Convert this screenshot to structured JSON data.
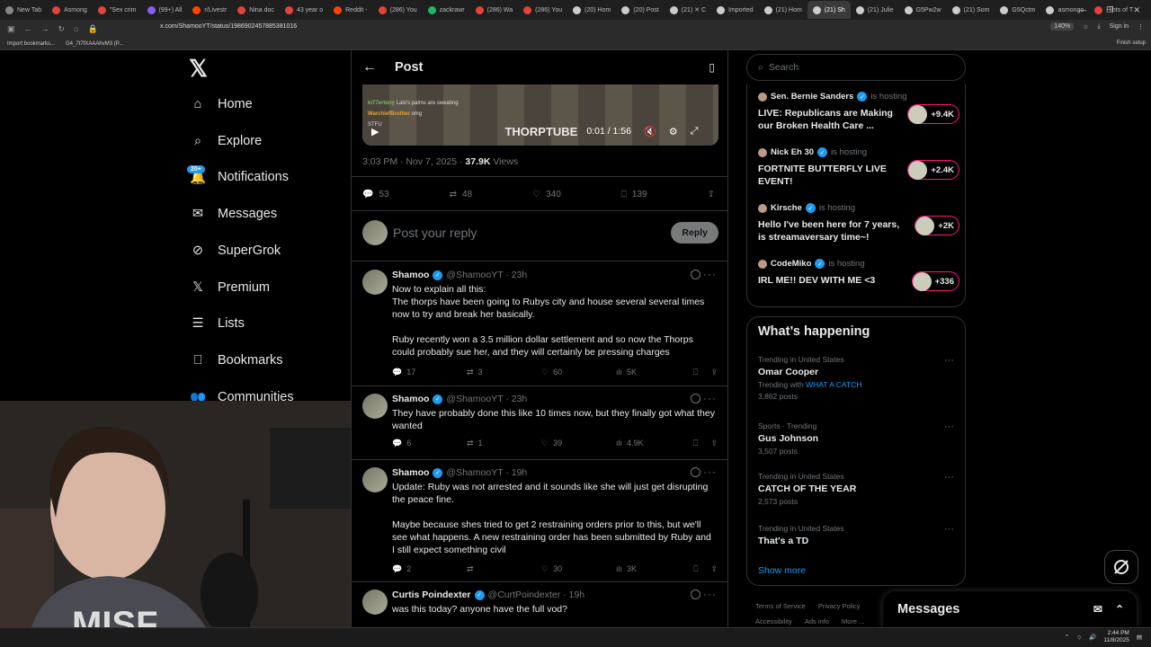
{
  "browser": {
    "tabs": [
      {
        "label": "New Tab",
        "color": "#888888"
      },
      {
        "label": "Asmong",
        "color": "#e0443a"
      },
      {
        "label": "\"Sex crim",
        "color": "#e0443a"
      },
      {
        "label": "(99+) All",
        "color": "#8a5cf6"
      },
      {
        "label": "r/Livestr",
        "color": "#ff4500"
      },
      {
        "label": "Nina doc",
        "color": "#e0443a"
      },
      {
        "label": "43 year o",
        "color": "#e0443a"
      },
      {
        "label": "Reddit -",
        "color": "#ff4500"
      },
      {
        "label": "(286) You",
        "color": "#e0443a"
      },
      {
        "label": "zackrawr",
        "color": "#1fb864"
      },
      {
        "label": "(286) Wa",
        "color": "#e0443a"
      },
      {
        "label": "(286) You",
        "color": "#e0443a"
      },
      {
        "label": "(20) Hom",
        "color": "#cccccc"
      },
      {
        "label": "(20) Post",
        "color": "#cccccc"
      },
      {
        "label": "(21) ✕ C",
        "color": "#cccccc"
      },
      {
        "label": "Imported",
        "color": "#cccccc"
      },
      {
        "label": "(21) Hom",
        "color": "#cccccc"
      },
      {
        "label": "(21) Sh",
        "color": "#cccccc",
        "active": true
      },
      {
        "label": "(21) Julie",
        "color": "#cccccc"
      },
      {
        "label": "G5Pw2w",
        "color": "#cccccc"
      },
      {
        "label": "(21) Som",
        "color": "#cccccc"
      },
      {
        "label": "G5Qctm",
        "color": "#cccccc"
      },
      {
        "label": "asmongo",
        "color": "#cccccc"
      },
      {
        "label": "Hints of T",
        "color": "#e0443a"
      }
    ],
    "url": "x.com/ShamooYT/status/1986902457885381016",
    "zoom": "140%",
    "signin": "Sign in",
    "bookmarks": [
      "Import bookmarks...",
      "G4_7t7fXAAAhvM3 (P..."
    ],
    "finish_setup": "Finish setup"
  },
  "leftnav": {
    "items": [
      {
        "label": "Home",
        "icon": "home-icon"
      },
      {
        "label": "Explore",
        "icon": "search-icon"
      },
      {
        "label": "Notifications",
        "icon": "bell-icon"
      },
      {
        "label": "Messages",
        "icon": "envelope-icon"
      },
      {
        "label": "SuperGrok",
        "icon": "grok-icon"
      },
      {
        "label": "Premium",
        "icon": "x-logo-icon"
      },
      {
        "label": "Lists",
        "icon": "list-icon"
      },
      {
        "label": "Bookmarks",
        "icon": "bookmark-icon"
      },
      {
        "label": "Communities",
        "icon": "people-icon"
      }
    ],
    "notifications_badge": "20+"
  },
  "post": {
    "header_title": "Post",
    "video": {
      "chat": [
        {
          "user": "ki77ertony",
          "msg": "Lalo's palms are sweating"
        },
        {
          "user": "WarchiefBrother",
          "msg": "omg"
        },
        {
          "user": "",
          "msg": "STFU"
        }
      ],
      "watermark": "THORPTUBE",
      "time": "0:01 / 1:56"
    },
    "timestamp": "3:03 PM · Nov 7, 2025 · ",
    "views_count": "37.9K",
    "views_label": " Views",
    "stats": {
      "replies": "53",
      "reposts": "48",
      "likes": "340",
      "bookmarks": "139"
    },
    "reply_placeholder": "Post your reply",
    "reply_button": "Reply"
  },
  "tweets": [
    {
      "name": "Shamoo",
      "handle": "@ShamooYT · 23h",
      "text": "Now to explain all this:\nThe thorps have been going to Rubys city and house several several times now to try and break her basically.\n\nRuby recently won a 3.5 million dollar settlement and so now the Thorps could probably sue her, and they will certainly be pressing charges",
      "replies": "17",
      "reposts": "3",
      "likes": "60",
      "views": "5K"
    },
    {
      "name": "Shamoo",
      "handle": "@ShamooYT · 23h",
      "text": "They have probably done this like 10 times now, but they finally got what they wanted",
      "replies": "6",
      "reposts": "1",
      "likes": "39",
      "views": "4.9K"
    },
    {
      "name": "Shamoo",
      "handle": "@ShamooYT · 19h",
      "text": "Update: Ruby was not arrested and it sounds like she will just get disrupting the peace fine.\n\nMaybe because shes tried to get 2 restraining orders prior to this, but we'll see what happens. A new restraining order has been submitted by Ruby and I still expect something civil",
      "replies": "2",
      "reposts": "",
      "likes": "30",
      "views": "3K"
    },
    {
      "name": "Curtis Poindexter",
      "handle": "@CurtPoindexter · 19h",
      "text": "was this today? anyone have the full vod?"
    }
  ],
  "right": {
    "search_placeholder": "Search",
    "spaces": [
      {
        "host": "Sen. Bernie Sanders",
        "hosting": "is hosting",
        "title": "LIVE: Republicans are Making our Broken Health Care ...",
        "listeners": "+9.4K"
      },
      {
        "host": "Nick Eh 30",
        "hosting": "is hosting",
        "title": "FORTNITE BUTTERFLY LIVE EVENT!",
        "listeners": "+2.4K"
      },
      {
        "host": "Kirsche",
        "hosting": "is hosting",
        "title": "Hello I've been here for 7 years, is streamaversary time~!",
        "listeners": "+2K"
      },
      {
        "host": "CodeMiko",
        "hosting": "is hosting",
        "title": "IRL ME!! DEV WITH ME <3",
        "listeners": "+336"
      }
    ],
    "happening_title": "What’s happening",
    "trends": [
      {
        "context": "Trending in United States",
        "name": "Omar Cooper",
        "with_label": "Trending with",
        "with_link": "WHAT A CATCH",
        "posts": "3,862 posts"
      },
      {
        "context": "Sports · Trending",
        "name": "Gus Johnson",
        "posts": "3,507 posts"
      },
      {
        "context": "Trending in United States",
        "name": "CATCH OF THE YEAR",
        "posts": "2,573 posts"
      },
      {
        "context": "Trending in United States",
        "name": "That's a TD",
        "posts": ""
      }
    ],
    "show_more": "Show more",
    "footer": [
      "Terms of Service",
      "Privacy Policy",
      "Accessibility",
      "Ads info",
      "More ..."
    ]
  },
  "messages_drawer": {
    "title": "Messages"
  },
  "taskbar": {
    "time": "2:44 PM",
    "date": "11/8/2025"
  },
  "colors": {
    "accent": "#1d9bf0",
    "live_border": "#f91880",
    "background": "#000000"
  }
}
